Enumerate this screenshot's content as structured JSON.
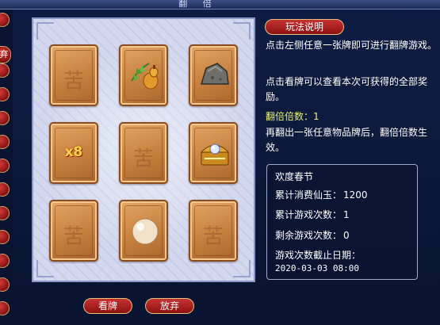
{
  "window": {
    "title": "翻 倍"
  },
  "side": {
    "tab_label": "弃"
  },
  "board": {
    "cards": [
      {
        "content": "glyph",
        "text": "苦",
        "name": "card-back"
      },
      {
        "content": "item",
        "icon": "herb-gourd-icon",
        "name": "card-herb-gourd"
      },
      {
        "content": "item",
        "icon": "stone-icon",
        "name": "card-stone"
      },
      {
        "content": "multiplier",
        "text": "x8",
        "name": "card-multiplier"
      },
      {
        "content": "glyph",
        "text": "苦",
        "name": "card-back"
      },
      {
        "content": "item",
        "icon": "treasure-chest-icon",
        "name": "card-treasure-chest"
      },
      {
        "content": "glyph",
        "text": "苦",
        "name": "card-back"
      },
      {
        "content": "item",
        "icon": "pearl-icon",
        "name": "card-pearl"
      },
      {
        "content": "glyph",
        "text": "苦",
        "name": "card-back"
      }
    ]
  },
  "panel": {
    "rules_button": "玩法说明",
    "desc1": "点击左侧任意一张牌即可进行翻牌游戏。",
    "desc2": "点击看牌可以查看本次可获得的全部奖励。",
    "multiplier_label": "翻倍倍数：",
    "multiplier_value": "1",
    "desc3": "再翻出一张任意物品牌后，翻倍倍数生效。"
  },
  "info": {
    "event_name": "欢度春节",
    "spent_label": "累计消费仙玉：",
    "spent_value": "1200",
    "played_label": "累计游戏次数：",
    "played_value": "1",
    "remaining_label": "剩余游戏次数：",
    "remaining_value": "0",
    "deadline_label": "游戏次数截止日期：",
    "deadline_value": "2020-03-03 08:00"
  },
  "buttons": {
    "view": "看牌",
    "quit": "放弃"
  },
  "colors": {
    "accent_red": "#a51b1b",
    "highlight_yellow": "#e6f07a",
    "card_orange": "#c6803f"
  }
}
